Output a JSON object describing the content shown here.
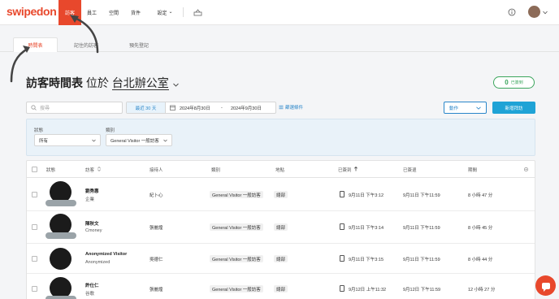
{
  "brand": {
    "logo": "swipedon"
  },
  "nav": {
    "items": [
      "訪客",
      "員工",
      "空間",
      "貨件",
      "設定"
    ],
    "settings_chevron": "⌄"
  },
  "subtabs": [
    "時間表",
    "記住的訪客",
    "預先登記"
  ],
  "page": {
    "title": "訪客時間表",
    "title_at": "位於",
    "location": "台北辦公室"
  },
  "signed_in": {
    "count": "0",
    "label": "已簽到"
  },
  "toolbar": {
    "search_placeholder": "搜尋",
    "date_range_button": "最近 30 天",
    "date_start": "2024年8月30日",
    "date_separator": "-",
    "date_end": "2024年9月30日",
    "filter_link": "篩選條件",
    "action_button": "動作",
    "add_button": "新增拜訪"
  },
  "filters": [
    {
      "label": "狀態",
      "value": "所有"
    },
    {
      "label": "類別",
      "value": "General Visitor 一般訪客"
    }
  ],
  "table": {
    "headers": {
      "status": "狀態",
      "visitor": "訪客",
      "host": "接待人",
      "category": "類別",
      "location": "地點",
      "signed_in": "已簽到",
      "signed_out": "已簽退",
      "duration": "期間"
    },
    "rows": [
      {
        "name": "劉秀惠",
        "company": "企業",
        "host": "紀卜心",
        "category": "General Visitor 一般訪客",
        "location": "總部",
        "in": "9月11日 下午3:12",
        "out": "9月11日 下午11:59",
        "duration": "8 小時 47 分"
      },
      {
        "name": "陳秋文",
        "company": "Cmoney",
        "host": "張麗煌",
        "category": "General Visitor 一般訪客",
        "location": "總部",
        "in": "9月11日 下午3:14",
        "out": "9月11日 下午11:59",
        "duration": "8 小時 45 分"
      },
      {
        "name": "Anonymized Visitor",
        "company": "Anonymized",
        "host": "吳德仁",
        "category": "General Visitor 一般訪客",
        "location": "總部",
        "in": "9月11日 下午3:15",
        "out": "9月11日 下午11:59",
        "duration": "8 小時 44 分"
      },
      {
        "name": "許仕仁",
        "company": "谷歌",
        "host": "張麗煌",
        "category": "General Visitor 一般訪客",
        "location": "總部",
        "in": "9月12日 上午11:32",
        "out": "9月12日 下午11:59",
        "duration": "12 小時 27 分"
      }
    ]
  },
  "colors": {
    "brand": "#e8482c",
    "primary": "#1fa3d6",
    "link": "#2a86c9",
    "success": "#3ba55c"
  },
  "icons": [
    "search-icon",
    "calendar-icon",
    "filter-icon",
    "help-icon",
    "reception-icon",
    "settings-gear-icon",
    "chat-icon",
    "sort-icon"
  ]
}
